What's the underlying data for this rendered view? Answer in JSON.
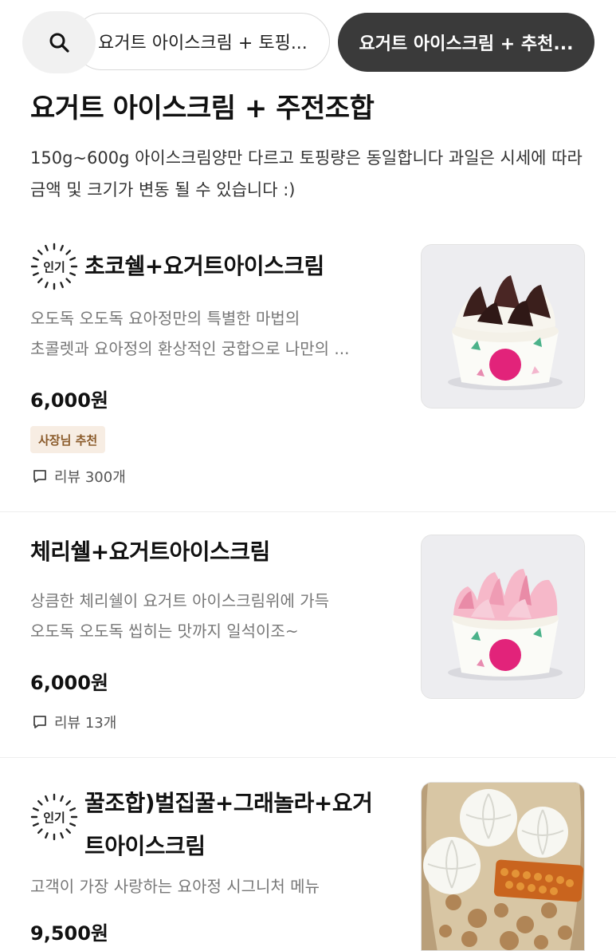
{
  "tabs": {
    "search_icon": "search-icon",
    "tab1": "요거트 아이스크림 + 토핑...",
    "tab2": "요거트 아이스크림 + 추천..."
  },
  "section": {
    "title": "요거트 아이스크림 + 주전조합",
    "description": "150g~600g 아이스크림양만 다르고 토핑량은 동일합니다 과일은 시세에 따라 금액 및 크기가 변동 될 수 있습니다 :)"
  },
  "items": [
    {
      "popular_label": "인기",
      "name": "초코쉘+요거트아이스크림",
      "desc_line1": "오도독 오도독 요아정만의 특별한 마법의",
      "desc_line2": "초콜렛과 요아정의 환상적인 궁합으로 나만의 ...",
      "price": "6,000원",
      "owner_badge": "사장님 추천",
      "reviews": "리뷰 300개"
    },
    {
      "name": "체리쉘+요거트아이스크림",
      "desc_line1": "상큼한 체리쉘이 요거트 아이스크림위에 가득",
      "desc_line2": "오도독 오도독 씹히는 맛까지 일석이조~",
      "price": "6,000원",
      "reviews": "리뷰 13개"
    },
    {
      "popular_label": "인기",
      "name_line1": "꿀조합)벌집꿀+그래놀라+요거",
      "name_line2": "트아이스크림",
      "desc_line1": "고객이 가장 사랑하는 요아정 시그니처 메뉴",
      "price": "9,500원"
    }
  ],
  "colors": {
    "dark_pill": "#3a3a3a",
    "owner_badge_bg": "#f7ede3",
    "owner_badge_text": "#8a5a2a"
  }
}
